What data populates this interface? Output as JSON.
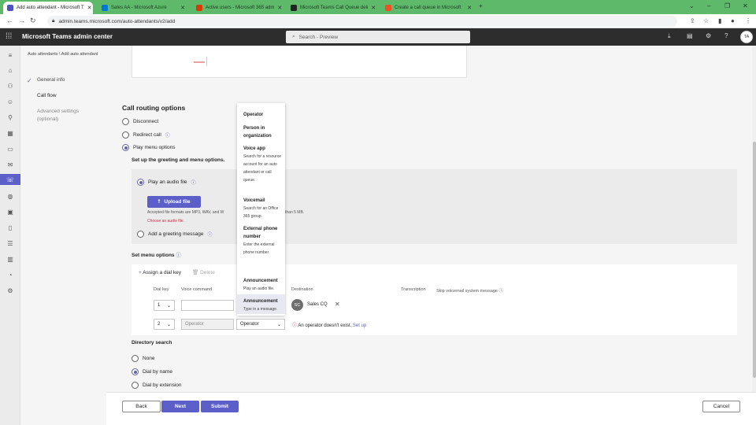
{
  "browser": {
    "tabs": [
      {
        "title": "Add auto attendant - Microsoft T",
        "fav": "#4b53bc"
      },
      {
        "title": "Sales AA - Microsoft Azure",
        "fav": "#0078d4"
      },
      {
        "title": "Active users - Microsoft 365 adm",
        "fav": "#d83b01"
      },
      {
        "title": "Microsoft Teams Call Queue deli",
        "fav": "#222222"
      },
      {
        "title": "Create a call queue in Microsoft",
        "fav": "#f25022"
      }
    ],
    "url": "admin.teams.microsoft.com/auto-attendants/v2/add"
  },
  "header": {
    "title": "Microsoft Teams admin center",
    "search_placeholder": "Search - Preview",
    "avatar": "TA"
  },
  "breadcrumb": "Auto attendants \\ Add auto attendant",
  "steps": {
    "general": "General info",
    "callflow": "Call flow",
    "advanced": "Advanced settings",
    "advanced_sub": "(optional)"
  },
  "routing": {
    "title": "Call routing options",
    "disconnect": "Disconnect",
    "redirect": "Redirect call",
    "play_menu": "Play menu options",
    "greeting_title": "Set up the greeting and menu options.",
    "play_audio": "Play an audio file",
    "upload": "Upload file",
    "accepted_a": "Accepted file formats are MP3, WAV, and W",
    "accepted_b": "than 5 MB.",
    "choose": "Choose an audio file.",
    "add_greeting": "Add a greeting message"
  },
  "menu": {
    "title": "Set menu options",
    "assign": "Assign a dial key",
    "delete": "Delete",
    "columns": {
      "dialkey": "Dial key",
      "voice": "Voice command",
      "dest": "Destination",
      "transcription": "Transcription",
      "skip": "Skip voicemail system message"
    },
    "rows": [
      {
        "key": "1",
        "voice": "",
        "dest_type": "",
        "dest_name": "Sales CQ",
        "dest_initials": "SC"
      },
      {
        "key": "2",
        "voice": "Operator",
        "dest_type": "Operator",
        "warning": "An operator doesn't exist.",
        "setup": "Set up"
      }
    ]
  },
  "dropdown": [
    {
      "label": "Operator",
      "desc": ""
    },
    {
      "label": "Person in organization",
      "desc": ""
    },
    {
      "label": "Voice app",
      "desc": "Search for a resource account for an auto attendant or call queue."
    },
    {
      "label": "Voicemail",
      "desc": "Search for an Office 365 group."
    },
    {
      "label": "External phone number",
      "desc": "Enter the external phone number"
    },
    {
      "label": "Announcement",
      "desc": "Play an audio file."
    },
    {
      "label": "Announcement",
      "desc": "Type in a message."
    }
  ],
  "directory": {
    "title": "Directory search",
    "none": "None",
    "byname": "Dial by name",
    "byext": "Dial by extension"
  },
  "footer": {
    "back": "Back",
    "next": "Next",
    "submit": "Submit",
    "cancel": "Cancel"
  },
  "colors": {
    "accent": "#5b5fc7",
    "tabbar": "#5fb96b",
    "warning": "#c4314b"
  }
}
